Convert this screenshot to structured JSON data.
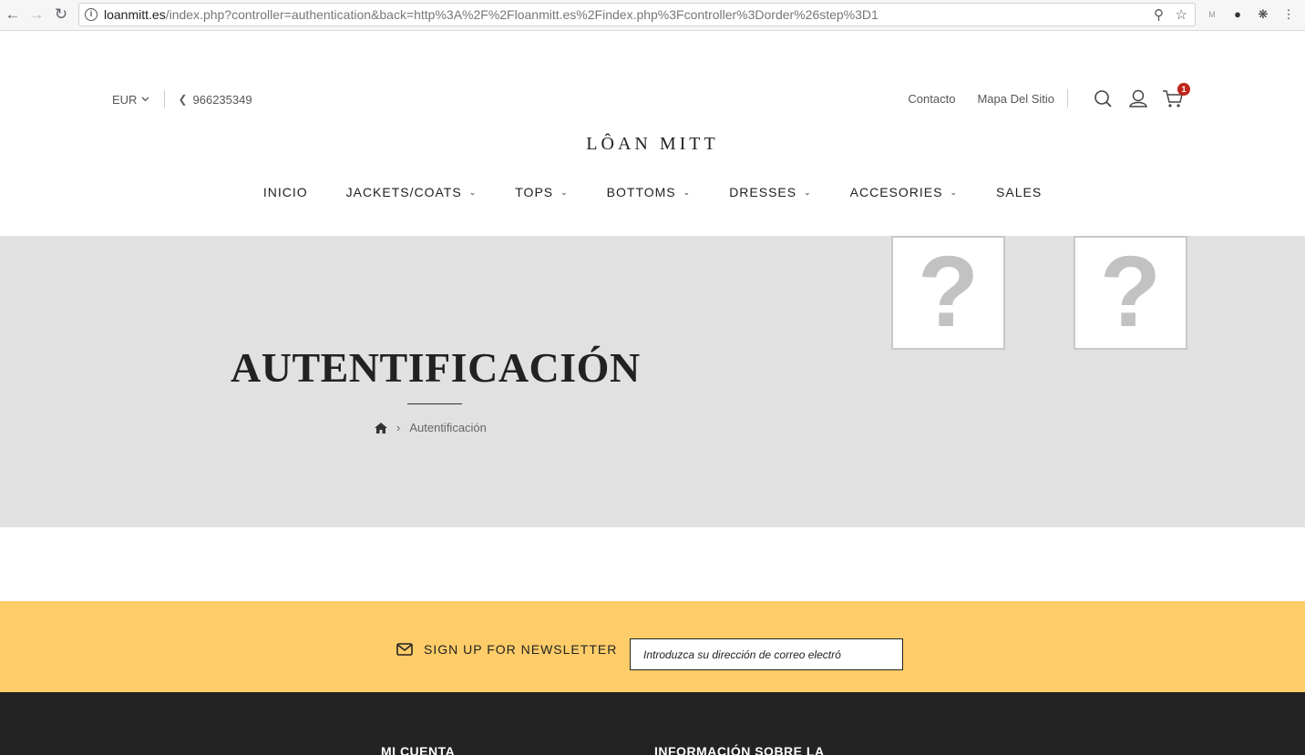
{
  "browser": {
    "url_host": "loanmitt.es",
    "url_path": "/index.php?controller=authentication&back=http%3A%2F%2Floanmitt.es%2Findex.php%3Fcontroller%3Dorder%26step%3D1"
  },
  "header": {
    "currency": "EUR",
    "phone": "966235349",
    "links": [
      "Contacto",
      "Mapa Del Sitio"
    ],
    "cart_count": "1",
    "logo": "LÔAN MITT"
  },
  "nav": [
    "INICIO",
    "JACKETS/COATS",
    "TOPS",
    "BOTTOMS",
    "DRESSES",
    "ACCESORIES",
    "SALES"
  ],
  "banner": {
    "title": "AUTENTIFICACIÓN",
    "breadcrumb_current": "Autentificación",
    "placeholder_glyph": "?"
  },
  "newsletter": {
    "label": "SIGN UP FOR NEWSLETTER",
    "placeholder": "Introduzca su dirección de correo electró"
  },
  "footer": {
    "headings": [
      "MI CUENTA",
      "INFORMACIÓN SOBRE LA"
    ]
  },
  "colors": {
    "banner_bg": "#e1e1e1",
    "newsletter_bg": "#fecd69",
    "footer_bg": "#232323",
    "badge": "#c0261b"
  }
}
